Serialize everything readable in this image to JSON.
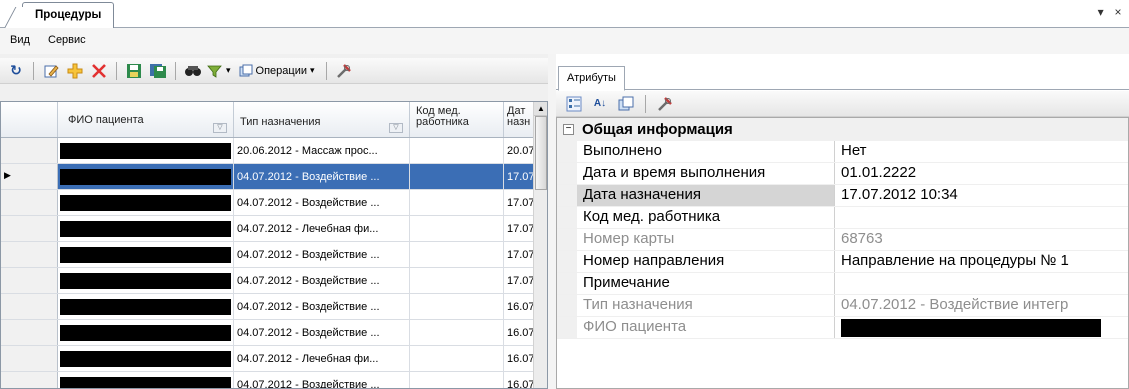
{
  "window": {
    "tab_title": "Процедуры",
    "controls": [
      "▾",
      "×"
    ]
  },
  "menu": [
    "Вид",
    "Сервис"
  ],
  "toolbar": {
    "icons": [
      "refresh-icon",
      "edit-icon",
      "add-icon",
      "delete-icon",
      "save-icon",
      "save-all-icon",
      "find-icon",
      "filter-icon"
    ],
    "operations_label": "Операции",
    "operations_arrow": "▾",
    "settings_icon": "tools-icon"
  },
  "grid": {
    "columns": [
      "ФИО пациента",
      "Тип назначения",
      "Код мед. работника",
      "Дат назн"
    ],
    "scroll_up": "▲",
    "rows": [
      {
        "type": "20.06.2012 - Массаж прос...",
        "code": "",
        "date": "20.07"
      },
      {
        "type": "04.07.2012 - Воздействие ...",
        "code": "",
        "date": "17.07",
        "selected": true
      },
      {
        "type": "04.07.2012 - Воздействие ...",
        "code": "",
        "date": "17.07"
      },
      {
        "type": "04.07.2012 - Лечебная фи...",
        "code": "",
        "date": "17.07"
      },
      {
        "type": "04.07.2012 - Воздействие ...",
        "code": "",
        "date": "17.07"
      },
      {
        "type": "04.07.2012 - Воздействие ...",
        "code": "",
        "date": "17.07"
      },
      {
        "type": "04.07.2012 - Воздействие ...",
        "code": "",
        "date": "16.07"
      },
      {
        "type": "04.07.2012 - Воздействие ...",
        "code": "",
        "date": "16.07"
      },
      {
        "type": "04.07.2012 - Лечебная фи...",
        "code": "",
        "date": "16.07"
      },
      {
        "type": "04.07.2012 - Воздействие ...",
        "code": "",
        "date": "16.07"
      }
    ]
  },
  "attributes": {
    "tab_label": "Атрибуты",
    "toolbar_icons": [
      "categorized-icon",
      "sort-az-icon",
      "pages-icon",
      "tools-icon"
    ],
    "category": "Общая информация",
    "category_toggle": "⊟",
    "properties": [
      {
        "name": "Выполнено",
        "value": "Нет"
      },
      {
        "name": "Дата и время выполнения",
        "value": "01.01.2222"
      },
      {
        "name": "Дата назначения",
        "value": "17.07.2012 10:34",
        "highlight": true
      },
      {
        "name": "Код мед. работника",
        "value": ""
      },
      {
        "name": "Номер карты",
        "value": "68763",
        "readonly": true
      },
      {
        "name": "Номер направления",
        "value": "Направление на процедуры № 1"
      },
      {
        "name": "Примечание",
        "value": ""
      },
      {
        "name": "Тип назначения",
        "value": "04.07.2012 - Воздействие интегр",
        "readonly": true
      },
      {
        "name": "ФИО пациента",
        "value": "",
        "readonly": true,
        "redacted": true
      }
    ]
  }
}
